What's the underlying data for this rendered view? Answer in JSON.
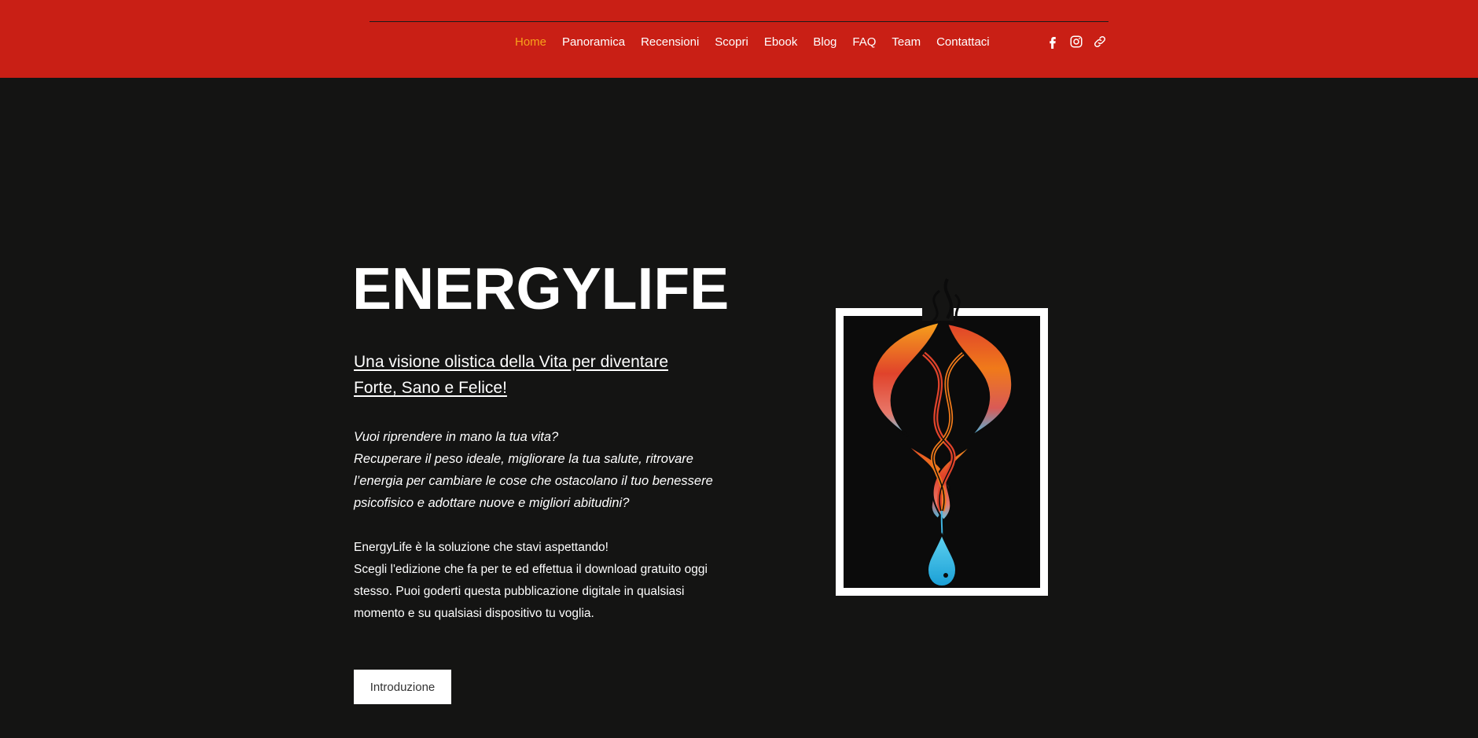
{
  "header": {
    "nav": [
      {
        "label": "Home",
        "active": true
      },
      {
        "label": "Panoramica",
        "active": false
      },
      {
        "label": "Recensioni",
        "active": false
      },
      {
        "label": "Scopri",
        "active": false
      },
      {
        "label": "Ebook",
        "active": false
      },
      {
        "label": "Blog",
        "active": false
      },
      {
        "label": "FAQ",
        "active": false
      },
      {
        "label": "Team",
        "active": false
      },
      {
        "label": "Contattaci",
        "active": false
      }
    ],
    "social_icons": [
      "facebook-icon",
      "instagram-icon",
      "link-icon"
    ]
  },
  "hero": {
    "title": "ENERGYLIFE",
    "subtitle": "Una visione olistica della Vita per diventare Forte, Sano e Felice!",
    "question_lines": [
      "Vuoi riprendere in mano la tua vita?",
      "Recuperare il peso ideale, migliorare la tua salute, ritrovare l’energia per cambiare le cose che ostacolano il tuo benessere psicofisico e adottare nuove e migliori abitudini?"
    ],
    "body_lines": [
      "EnergyLife è la soluzione che stavi aspettando!",
      "Scegli l'edizione che fa per te ed effettua il download gratuito oggi stesso. Puoi goderti questa pubblicazione digitale in qualsiasi momento e su qualsiasi dispositivo tu voglia."
    ],
    "cta_label": "Introduzione"
  },
  "colors": {
    "header_bg": "#c91f15",
    "page_bg": "#141413",
    "nav_active": "#f7a21b",
    "flame_orange": "#f07a1a",
    "flame_red": "#e0432b",
    "drop_blue": "#2bb6e6"
  }
}
